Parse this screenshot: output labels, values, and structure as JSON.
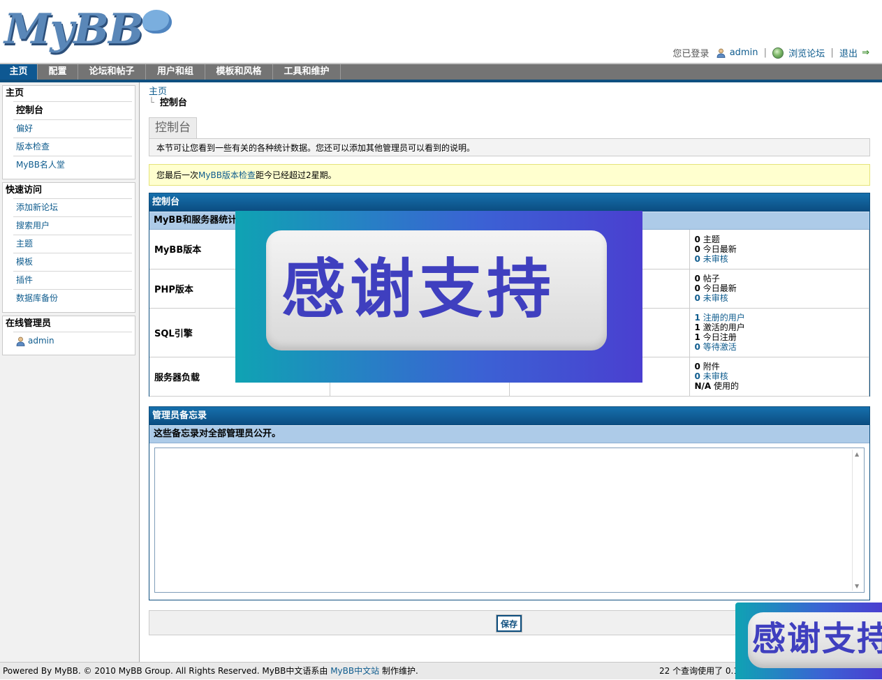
{
  "header": {
    "logo_text": "MyBB",
    "logged_in_label": "您已登录",
    "username": "admin",
    "view_forum": "浏览论坛",
    "logout": "退出"
  },
  "nav": {
    "tabs": [
      {
        "label": "主页",
        "active": true
      },
      {
        "label": "配置"
      },
      {
        "label": "论坛和帖子"
      },
      {
        "label": "用户和组"
      },
      {
        "label": "模板和风格"
      },
      {
        "label": "工具和维护"
      }
    ]
  },
  "sidebar": {
    "home": {
      "title": "主页",
      "items": [
        "控制台",
        "偏好",
        "版本检查",
        "MyBB名人堂"
      ]
    },
    "quick": {
      "title": "快速访问",
      "items": [
        "添加新论坛",
        "搜索用户",
        "主题",
        "模板",
        "插件",
        "数据库备份"
      ]
    },
    "online": {
      "title": "在线管理员",
      "admin": "admin"
    }
  },
  "breadcrumb": {
    "root": "主页",
    "current": "控制台"
  },
  "page": {
    "tab_title": "控制台",
    "description": "本节可让您看到一些有关的各种统计数据。您还可以添加其他管理员可以看到的说明。",
    "notice_before": "您最后一次",
    "notice_link": "MyBB版本检查",
    "notice_after": "距今已经超过2星期。"
  },
  "stats": {
    "header": "控制台",
    "subheader": "MyBB和服务器统计",
    "rows": [
      {
        "label": "MyBB版本",
        "stats": [
          {
            "num": "0",
            "text": "主题"
          },
          {
            "num": "0",
            "text": "今日最新"
          },
          {
            "num": "0",
            "text": "未审核",
            "link": true
          }
        ]
      },
      {
        "label": "PHP版本",
        "stats": [
          {
            "num": "0",
            "text": "帖子"
          },
          {
            "num": "0",
            "text": "今日最新"
          },
          {
            "num": "0",
            "text": "未审核",
            "link": true
          }
        ]
      },
      {
        "label": "SQL引擎",
        "stats": [
          {
            "num": "1",
            "text": "注册的用户",
            "link": true
          },
          {
            "num": "1",
            "text": "激活的用户"
          },
          {
            "num": "1",
            "text": "今日注册"
          },
          {
            "num": "0",
            "text": "等待激活",
            "link": true
          }
        ]
      },
      {
        "label": "服务器负载",
        "stats": [
          {
            "num": "0",
            "text": "附件"
          },
          {
            "num": "0",
            "text": "未审核",
            "link": true
          },
          {
            "num": "N/A",
            "text": "使用的"
          }
        ]
      }
    ]
  },
  "notes": {
    "header": "管理员备忘录",
    "subheader": "这些备忘录对全部管理员公开。",
    "value": ""
  },
  "save_label": "保存",
  "footer": {
    "left_text": "Powered By MyBB. © 2010 MyBB Group. All Rights Reserved. MyBB中文语系由",
    "link": "MyBB中文站",
    "left_after": "制作维护.",
    "right_text": "22 个查询使用了 0.1"
  },
  "overlay": {
    "text": "感谢支持"
  },
  "colors": {
    "nav_active": "#0e5892",
    "panel_header": "#0b4c80",
    "subheader": "#adcbe8",
    "link": "#0f5c8e",
    "notice_bg": "#ffffcf"
  }
}
